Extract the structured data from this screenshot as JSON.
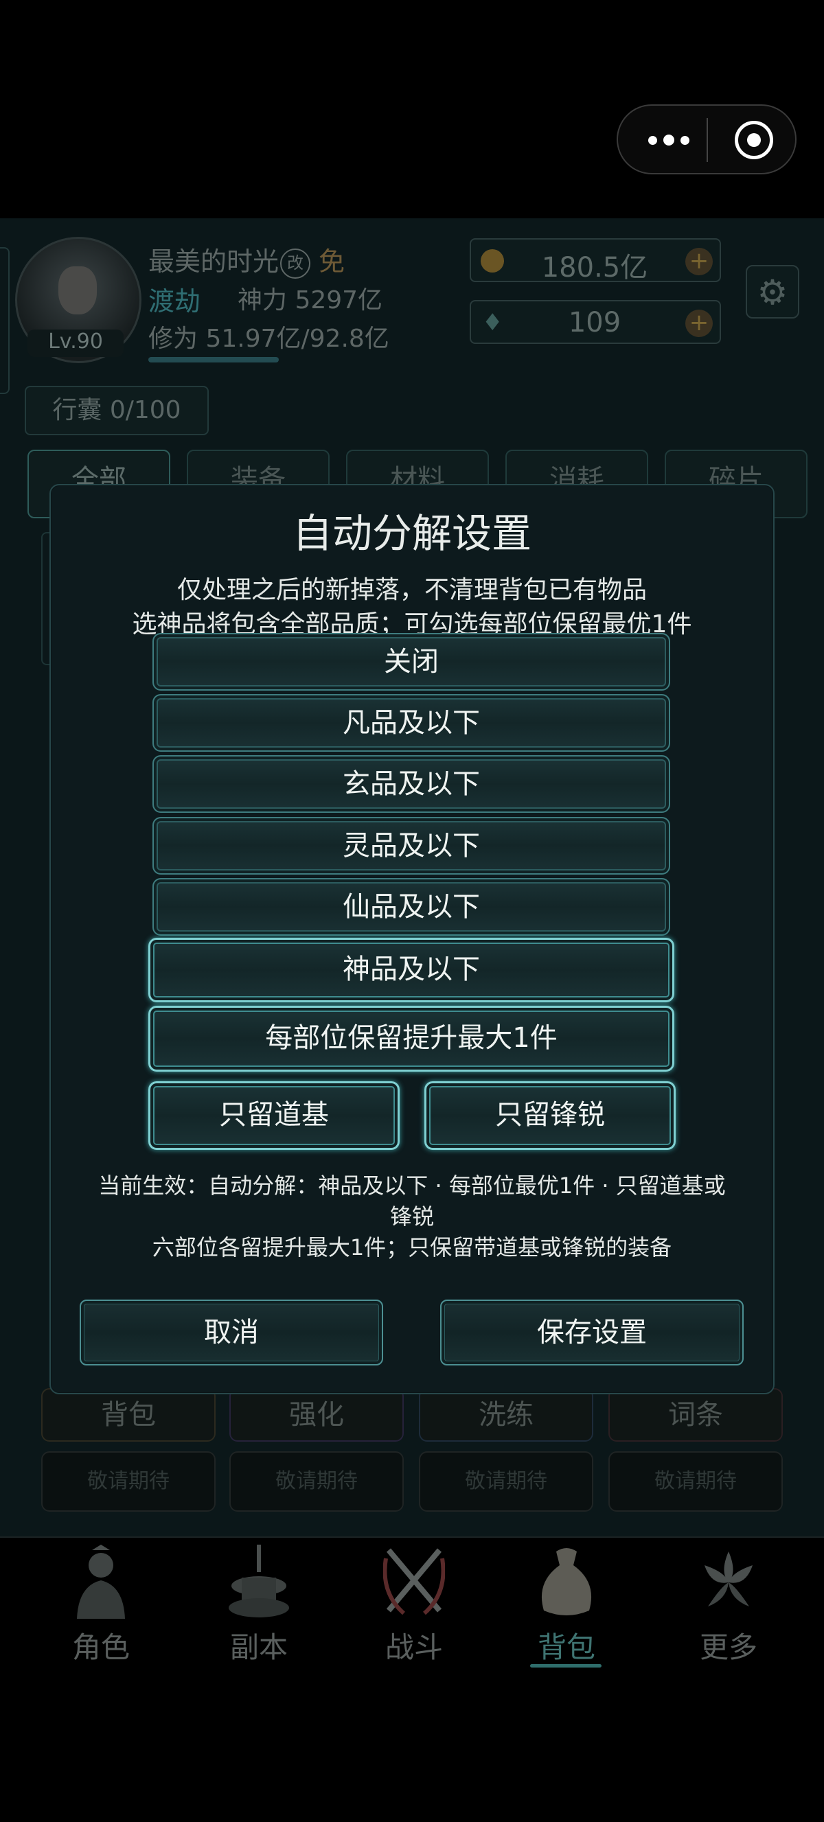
{
  "player": {
    "name": "最美的时光",
    "rename_glyph": "改",
    "free_tag": "免",
    "level": "Lv.90",
    "realm": "渡劫",
    "power": "神力 5297亿",
    "cultivation": "修为 51.97亿/92.8亿",
    "cultivation_progress": 0.56
  },
  "resources": {
    "gold": "180.5亿",
    "jade": "109"
  },
  "bag": {
    "capacity_label": "行囊 0/100"
  },
  "categories": [
    "全部",
    "装备",
    "材料",
    "消耗",
    "碎片"
  ],
  "bottom_buttons": [
    "背包",
    "强化",
    "洗练",
    "词条"
  ],
  "coming_soon": [
    "敬请期待",
    "敬请期待",
    "敬请期待",
    "敬请期待"
  ],
  "nav": {
    "items": [
      "角色",
      "副本",
      "战斗",
      "背包",
      "更多"
    ],
    "active": "背包"
  },
  "modal": {
    "title": "自动分解设置",
    "desc1": "仅处理之后的新掉落，不清理背包已有物品",
    "desc2": "选神品将包含全部品质；可勾选每部位保留最优1件",
    "options": [
      "关闭",
      "凡品及以下",
      "玄品及以下",
      "灵品及以下",
      "仙品及以下",
      "神品及以下"
    ],
    "selected_option": "神品及以下",
    "keep_best": "每部位保留提升最大1件",
    "keep_daoji": "只留道基",
    "keep_fengrui": "只留锋锐",
    "status_line1": "当前生效：自动分解：神品及以下 · 每部位最优1件 · 只留道基或",
    "status_line2": "锋锐",
    "status_line3": "六部位各留提升最大1件；只保留带道基或锋锐的装备",
    "cancel": "取消",
    "save": "保存设置"
  },
  "colors": {
    "accent": "#7fd0d2",
    "modal_bg": "#0d1a1d",
    "nav_active": "#3f7472"
  }
}
